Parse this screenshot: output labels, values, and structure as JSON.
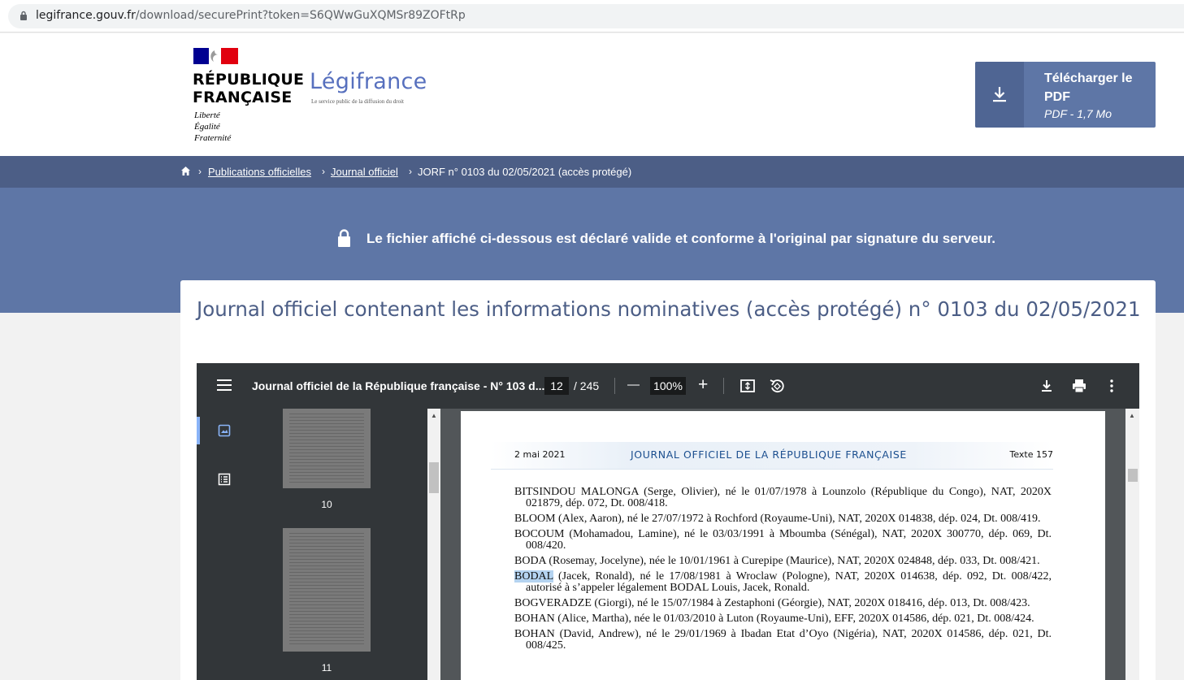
{
  "browser": {
    "domain": "legifrance.gouv.fr",
    "path": "/download/securePrint?token=S6QWwGuXQMSr89ZOFtRp"
  },
  "header": {
    "rf_line1": "RÉPUBLIQUE",
    "rf_line2": "FRANÇAISE",
    "motto1": "Liberté",
    "motto2": "Égalité",
    "motto3": "Fraternité",
    "brand": "Légifrance",
    "brand_sub": "Le service public de la diffusion du droit",
    "download_label": "Télécharger le PDF",
    "download_size": "PDF - 1,7 Mo"
  },
  "breadcrumb": {
    "items": [
      "Publications officielles",
      "Journal officiel",
      "JORF n° 0103 du 02/05/2021 (accès protégé)"
    ],
    "separator": "›"
  },
  "banner": {
    "message": "Le fichier affiché ci-dessous est déclaré valide et conforme à l'original par signature du serveur."
  },
  "card": {
    "title": "Journal officiel contenant les informations nominatives (accès protégé) n° 0103 du 02/05/2021"
  },
  "viewer": {
    "doc_title": "Journal officiel de la République française - N° 103 d...",
    "current_page": "12",
    "total_pages": "/ 245",
    "zoom": "100%",
    "zoom_out": "—",
    "zoom_in": "+",
    "thumbnails": [
      {
        "label": "10"
      },
      {
        "label": "11"
      }
    ]
  },
  "page": {
    "date": "2 mai 2021",
    "journal": "JOURNAL OFFICIEL DE LA RÉPUBLIQUE FRANÇAISE",
    "texte": "Texte 157",
    "entries": [
      "BITSINDOU MALONGA (Serge, Olivier), né le 01/07/1978 à Lounzolo (République du Congo), NAT, 2020X 021879, dép. 072, Dt. 008/418.",
      "BLOOM (Alex, Aaron), né le 27/07/1972 à Rochford (Royaume-Uni), NAT, 2020X 014838, dép. 024, Dt. 008/419.",
      "BOCOUM (Mohamadou, Lamine), né le 03/03/1991 à Mboumba (Sénégal), NAT, 2020X 300770, dép. 069, Dt. 008/420.",
      "BODA (Rosemay, Jocelyne), née le 10/01/1961 à Curepipe (Maurice), NAT, 2020X 024848, dép. 033, Dt. 008/421.",
      "",
      "BOGVERADZE (Giorgi), né le 15/07/1984 à Zestaphoni (Géorgie), NAT, 2020X 018416, dép. 013, Dt. 008/423.",
      "BOHAN (Alice, Martha), née le 01/03/2010 à Luton (Royaume-Uni), EFF, 2020X 014586, dép. 021, Dt. 008/424.",
      "BOHAN (David, Andrew), né le 29/01/1969 à Ibadan Etat d’Oyo (Nigéria), NAT, 2020X 014586, dép. 021, Dt. 008/425."
    ],
    "highlight_name": "BODAL",
    "highlight_rest": " (Jacek, Ronald), né le 17/08/1981 à Wroclaw (Pologne), NAT, 2020X 014638, dép. 092, Dt. 008/422, autorisé à s’appeler légalement BODAL Louis, Jacek, Ronald."
  },
  "colors": {
    "brand_blue": "#5e76a6",
    "dark_blue": "#4c5e86",
    "legi_blue": "#5770be",
    "flag_blue": "#000091",
    "flag_red": "#e1000f"
  }
}
